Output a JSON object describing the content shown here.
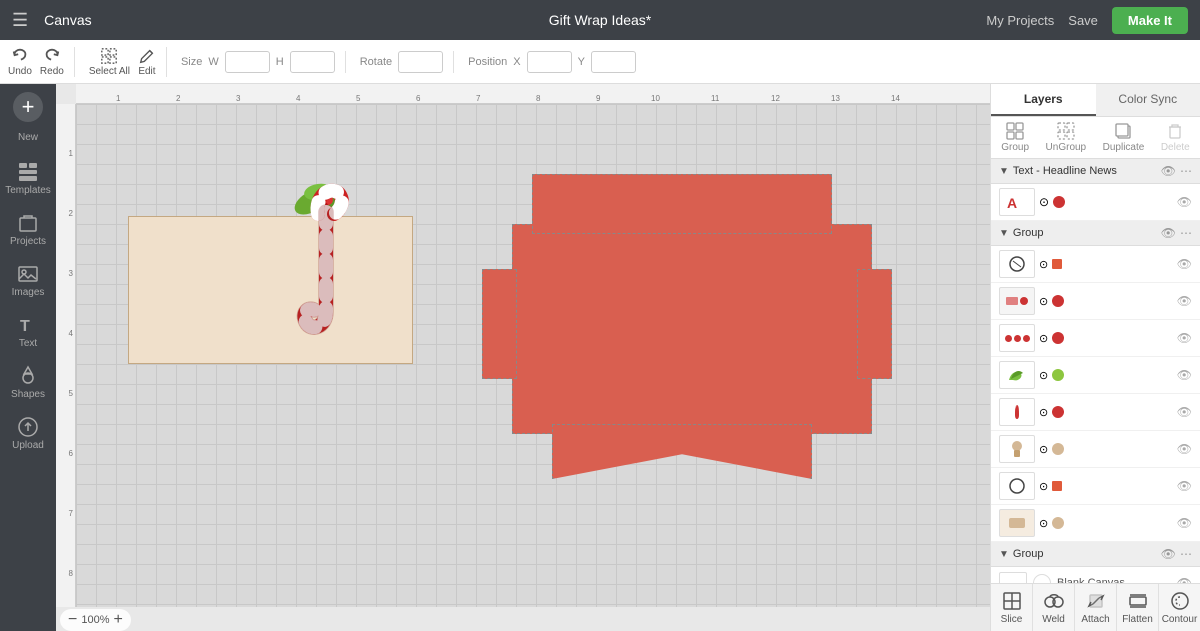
{
  "topbar": {
    "app_title": "Canvas",
    "doc_title": "Gift Wrap Ideas*",
    "my_projects": "My Projects",
    "save": "Save",
    "make_it": "Make It"
  },
  "toolbar": {
    "undo": "Undo",
    "redo": "Redo",
    "select_all": "Select All",
    "edit": "Edit",
    "size_label": "Size",
    "w_label": "W",
    "h_label": "H",
    "rotate_label": "Rotate",
    "position_label": "Position",
    "x_label": "X",
    "y_label": "Y"
  },
  "sidebar": {
    "items": [
      {
        "label": "New",
        "icon": "plus"
      },
      {
        "label": "Templates",
        "icon": "templates"
      },
      {
        "label": "Projects",
        "icon": "projects"
      },
      {
        "label": "Images",
        "icon": "images"
      },
      {
        "label": "Text",
        "icon": "text"
      },
      {
        "label": "Shapes",
        "icon": "shapes"
      },
      {
        "label": "Upload",
        "icon": "upload"
      }
    ]
  },
  "panel": {
    "tabs": [
      "Layers",
      "Color Sync"
    ],
    "active_tab": "Layers",
    "layer_actions": [
      "Group",
      "UnGroup",
      "Duplicate",
      "Delete"
    ],
    "groups": [
      {
        "name": "Text - Headline News",
        "items": [
          {
            "type": "text-red",
            "has_lock": true,
            "has_color": "red"
          }
        ]
      },
      {
        "name": "Group",
        "items": [
          {
            "type": "circle-lock",
            "has_pencil": true
          },
          {
            "type": "rect-lock",
            "color1": "pink",
            "color2": "red"
          },
          {
            "type": "circles",
            "color": "red"
          },
          {
            "type": "leaf",
            "color": "green"
          },
          {
            "type": "cane",
            "color": "red"
          },
          {
            "type": "mushroom",
            "color": "beige"
          },
          {
            "type": "circle-lock2",
            "has_pencil": true
          },
          {
            "type": "rect-beige",
            "color": "beige"
          }
        ]
      },
      {
        "name": "Group",
        "items": [
          {
            "type": "blank",
            "label": "Blank Canvas"
          }
        ]
      }
    ]
  },
  "bottom_actions": [
    "Slice",
    "Weld",
    "Attach",
    "Flatten",
    "Contour"
  ],
  "zoom": "100%",
  "ruler_marks_h": [
    "1",
    "2",
    "3",
    "4",
    "5",
    "6",
    "7",
    "8",
    "9",
    "10",
    "11",
    "12",
    "13",
    "14"
  ],
  "ruler_marks_v": [
    "1",
    "2",
    "3",
    "4",
    "5",
    "6",
    "7",
    "8"
  ]
}
